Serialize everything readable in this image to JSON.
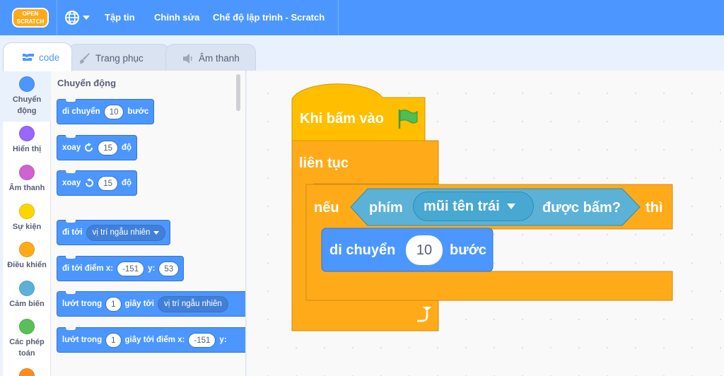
{
  "menubar": {
    "logo_top": "OPEN",
    "logo_bottom": "SCRATCH",
    "file": "Tập tin",
    "edit": "Chỉnh sửa",
    "project_title": "Chế độ lập trình - Scratch"
  },
  "tabs": [
    {
      "label": "code",
      "active": true
    },
    {
      "label": "Trang phục",
      "active": false
    },
    {
      "label": "Âm thanh",
      "active": false
    }
  ],
  "categories": [
    {
      "label": "Chuyển động",
      "color": "#4c97ff"
    },
    {
      "label": "Hiển thị",
      "color": "#9966ff"
    },
    {
      "label": "Âm thanh",
      "color": "#cf63cf"
    },
    {
      "label": "Sự kiện",
      "color": "#ffd500"
    },
    {
      "label": "Điều khiển",
      "color": "#ffab19"
    },
    {
      "label": "Cảm biến",
      "color": "#5cb1d6"
    },
    {
      "label": "Các phép toán",
      "color": "#59c059"
    },
    {
      "label": "",
      "color": "#ff8c1a"
    }
  ],
  "palette": {
    "title": "Chuyển động",
    "blocks": {
      "move": {
        "pre": "di chuyển",
        "value": "10",
        "post": "bước"
      },
      "turn_right": {
        "pre": "xoay",
        "value": "15",
        "post": "độ"
      },
      "turn_left": {
        "pre": "xoay",
        "value": "15",
        "post": "độ"
      },
      "goto": {
        "pre": "đi tới",
        "option": "vị trí ngẫu nhiên"
      },
      "goto_xy": {
        "pre": "đi tới điểm x:",
        "x": "-151",
        "ylabel": "y:",
        "y": "53"
      },
      "glide": {
        "pre": "lướt trong",
        "value": "1",
        "mid": "giây tới",
        "option": "vị trí ngẫu nhiên"
      },
      "glide_xy": {
        "pre": "lướt trong",
        "value": "1",
        "mid": "giây tới điểm x:",
        "x": "-151",
        "ylabel": "y:"
      }
    }
  },
  "script": {
    "hat": "Khi bấm vào",
    "forever": "liên tục",
    "if_label": "nếu",
    "then_label": "thì",
    "key_label": "phím",
    "key_option": "mũi tên trái",
    "pressed_label": "được bấm?",
    "move_label": "di chuyển",
    "move_value": "10",
    "move_unit": "bước"
  },
  "colors": {
    "menubar": "#4c97ff",
    "motion": "#4c97ff",
    "events": "#ffbf00",
    "control": "#ffab19",
    "sensing": "#5cb1d6"
  }
}
